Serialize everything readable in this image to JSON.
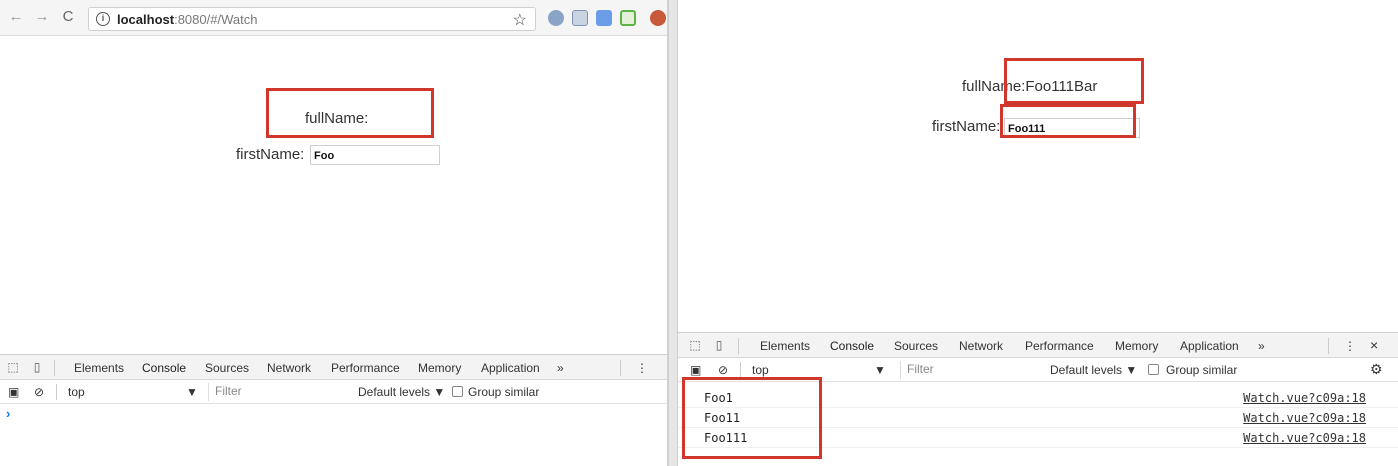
{
  "left": {
    "address_bar": {
      "back_icon": "←",
      "forward_icon": "→",
      "reload_icon": "C",
      "url_host": "localhost",
      "url_rest": ":8080/#/Watch",
      "star_icon": "☆"
    },
    "page": {
      "fullname_label": "fullName:",
      "firstname_label": "firstName:",
      "firstname_value": "Foo"
    },
    "devtools": {
      "tabs": [
        "Elements",
        "Console",
        "Sources",
        "Network",
        "Performance",
        "Memory",
        "Application"
      ],
      "active_tab": "Console",
      "more_icon": "»",
      "context": "top",
      "filter_placeholder": "Filter",
      "levels": "Default levels ▼",
      "group_similar": "Group similar",
      "prompt": "›"
    }
  },
  "right": {
    "page": {
      "fullname_label": "fullName:Foo111Bar",
      "firstname_label": "firstName:",
      "firstname_value": "Foo111"
    },
    "devtools": {
      "tabs": [
        "Elements",
        "Console",
        "Sources",
        "Network",
        "Performance",
        "Memory",
        "Application"
      ],
      "active_tab": "Console",
      "more_icon": "»",
      "context": "top",
      "filter_placeholder": "Filter",
      "levels": "Default levels ▼",
      "group_similar": "Group similar",
      "close_icon": "×",
      "console_rows": [
        {
          "message": "Foo1",
          "source": "Watch.vue?c09a:18"
        },
        {
          "message": "Foo11",
          "source": "Watch.vue?c09a:18"
        },
        {
          "message": "Foo111",
          "source": "Watch.vue?c09a:18"
        }
      ]
    }
  },
  "colors": {
    "highlight_box": "#d0362a",
    "active_tab_underline": "#1a73e8"
  }
}
